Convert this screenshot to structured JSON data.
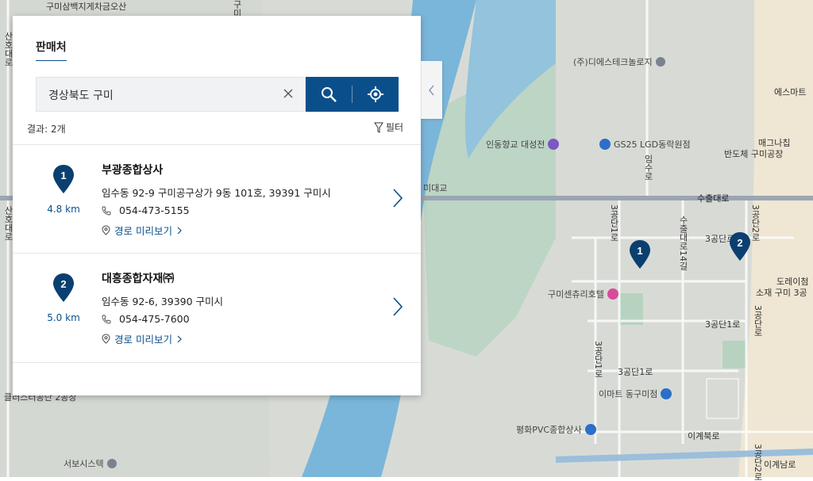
{
  "panel": {
    "tab": "판매처",
    "search": {
      "value": "경상북도 구미"
    },
    "result_count": "결과: 2개",
    "filter_label": "필터",
    "results": [
      {
        "num": "1",
        "distance": "4.8 km",
        "name": "부광종합상사",
        "address": "임수동 92-9 구미공구상가 9동 101호, 39391 구미시",
        "phone": "054-473-5155",
        "route_label": "경로 미리보기"
      },
      {
        "num": "2",
        "distance": "5.0 km",
        "name": "대흥종합자재㈜",
        "address": "임수동 92-6, 39390 구미시",
        "phone": "054-475-7600",
        "route_label": "경로 미리보기"
      }
    ]
  },
  "map": {
    "labels": {
      "poi_top_left": "구미삼백지게차금오산",
      "poi_disetech": "(주)디에스테크놀로지",
      "poi_esmart": "에스마트",
      "poi_sentinel": "인동향교 대성전",
      "poi_gs25": "GS25 LGD동락원점",
      "poi_maegna": "매그나칩",
      "poi_bandoche": "반도체 구미공장",
      "poi_bridge": "미대교",
      "road_suchul": "수출대로",
      "road_imsu": "임수로",
      "road_3gongdan1_v": "3공단1로",
      "road_suchul14": "수출대로14길",
      "road_3gongdan2_v": "3공단2로",
      "road_3gongdan_top": "3공단로",
      "poi_doreich": "도레이첨",
      "poi_sojae": "소재 구미 3공",
      "poi_hotel": "구미센츄리호텔",
      "road_3gongdan1_h": "3공단1로",
      "road_3gongdan_v2": "3공단로",
      "road_3gongdan1_v2": "3공단1로",
      "road_3gongdan1_h2": "3공단1로",
      "poi_emart": "이마트 동구미점",
      "poi_pyeonghwa": "평화PVC종합상사",
      "road_igyebuk": "이계북로",
      "road_igyenam": "이계남로",
      "poi_seobo": "서보시스텍",
      "road_left_v1": "산호대로",
      "road_left_v2": "산호대로",
      "road_top_v": "구미대로",
      "road_3gongdan2_v2": "3공단2로",
      "poi_bottom_left": "클러스터공단 2공장"
    },
    "markers": [
      "1",
      "2"
    ]
  },
  "colors": {
    "accent": "#0b4f8a",
    "water": "#7fb8db",
    "land": "#d9dcd6"
  }
}
